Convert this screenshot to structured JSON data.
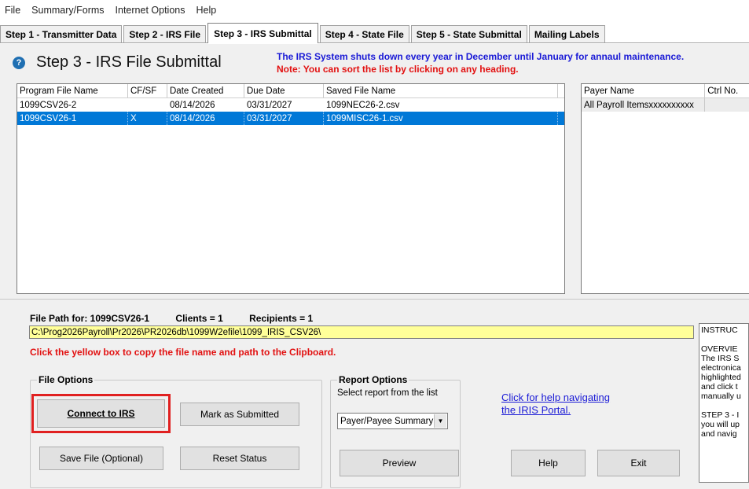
{
  "menu": [
    "File",
    "Summary/Forms",
    "Internet Options",
    "Help"
  ],
  "tabs": [
    {
      "label": "Step 1 - Transmitter Data"
    },
    {
      "label": "Step 2 - IRS File"
    },
    {
      "label": "Step 3 - IRS Submittal",
      "active": true
    },
    {
      "label": "Step 4 - State File"
    },
    {
      "label": "Step 5 - State Submittal"
    },
    {
      "label": "Mailing Labels"
    }
  ],
  "header": {
    "title": "Step 3 - IRS File Submittal",
    "notice": "The IRS System shuts down every year in December until January for annaul maintenance.",
    "sort_note": "Note: You can sort the list by clicking on any heading."
  },
  "file_list": {
    "columns": [
      "Program File Name",
      "CF/SF",
      "Date Created",
      "Due Date",
      "Saved File Name"
    ],
    "rows": [
      {
        "program": "1099CSV26-2",
        "cfsf": "",
        "created": "08/14/2026",
        "due": "03/31/2027",
        "saved": "1099NEC26-2.csv",
        "selected": false
      },
      {
        "program": "1099CSV26-1",
        "cfsf": "X",
        "created": "08/14/2026",
        "due": "03/31/2027",
        "saved": "1099MISC26-1.csv",
        "selected": true
      }
    ]
  },
  "payer_list": {
    "columns": [
      "Payer Name",
      "Ctrl No."
    ],
    "rows": [
      {
        "payer": "All Payroll Itemsxxxxxxxxxx",
        "ctrl": ""
      }
    ]
  },
  "file_info": {
    "path_for_label": "File Path for: 1099CSV26-1",
    "clients": "Clients = 1",
    "recipients": "Recipients = 1",
    "path": "C:\\Prog2026Payroll\\Pr2026\\PR2026db\\1099W2efile\\1099_IRIS_CSV26\\",
    "clipboard_note": "Click the yellow box to copy the file name and path to the Clipboard."
  },
  "file_options": {
    "legend": "File Options",
    "connect": "Connect to IRS",
    "mark": "Mark as Submitted",
    "save": "Save File (Optional)",
    "reset": "Reset Status"
  },
  "report_options": {
    "legend": "Report Options",
    "subtitle": "Select report from the list",
    "selected": "Payer/Payee Summary",
    "preview": "Preview"
  },
  "help_link": {
    "line1": "Click for help navigating",
    "line2": "the IRIS Portal."
  },
  "buttons": {
    "help": "Help",
    "exit": "Exit"
  },
  "instructions": [
    "INSTRUC",
    "",
    "OVERVIE",
    "The IRS S",
    "electronica",
    "highlighted",
    "and click t",
    "manually u",
    "",
    "STEP 3 - I",
    "you will up",
    "and navig"
  ],
  "colors": {
    "accent": "#0078d7",
    "notice_blue": "#1a1ad6",
    "notice_red": "#e21010",
    "path_yellow": "#ffff99"
  }
}
